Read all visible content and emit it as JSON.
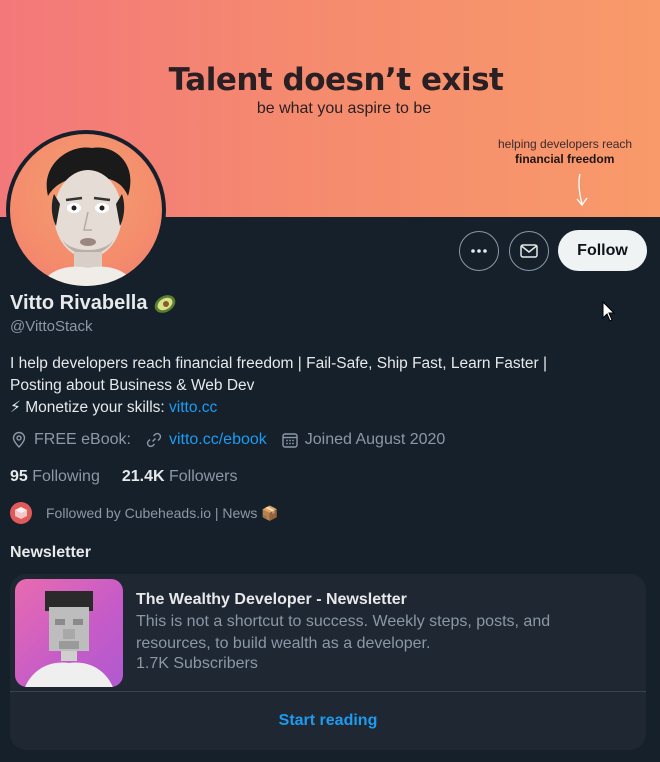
{
  "banner": {
    "title": "Talent doesn’t exist",
    "subtitle": "be what you aspire to be",
    "aside_line1": "helping developers reach",
    "aside_line2": "financial freedom"
  },
  "actions": {
    "more_icon": "more-dots-icon",
    "message_icon": "mail-icon",
    "follow_label": "Follow"
  },
  "profile": {
    "name": "Vitto Rivabella",
    "name_emoji": "avocado-icon",
    "handle": "@VittoStack",
    "bio_line1": "I help developers reach financial freedom | Fail-Safe, Ship Fast, Learn Faster |",
    "bio_line2": "Posting about Business & Web Dev",
    "bio_line3_prefix": "⚡ Monetize your skills: ",
    "bio_link": "vitto.cc"
  },
  "meta": {
    "location": "FREE eBook:",
    "url": "vitto.cc/ebook",
    "joined": "Joined August 2020"
  },
  "counts": {
    "following_count": "95",
    "following_label": "Following",
    "followers_count": "21.4K",
    "followers_label": "Followers"
  },
  "followed_by": {
    "text": "Followed by Cubeheads.io | News 📦"
  },
  "newsletter": {
    "section_title": "Newsletter",
    "title": "The Wealthy Developer - Newsletter",
    "description": "This is not a shortcut to success. Weekly steps, posts, and resources, to build wealth as a developer.",
    "subscribers": "1.7K Subscribers",
    "cta": "Start reading"
  },
  "colors": {
    "background": "#15202b",
    "accent": "#1d9bf0",
    "banner_start": "#f3787a",
    "banner_end": "#f89a6a"
  }
}
